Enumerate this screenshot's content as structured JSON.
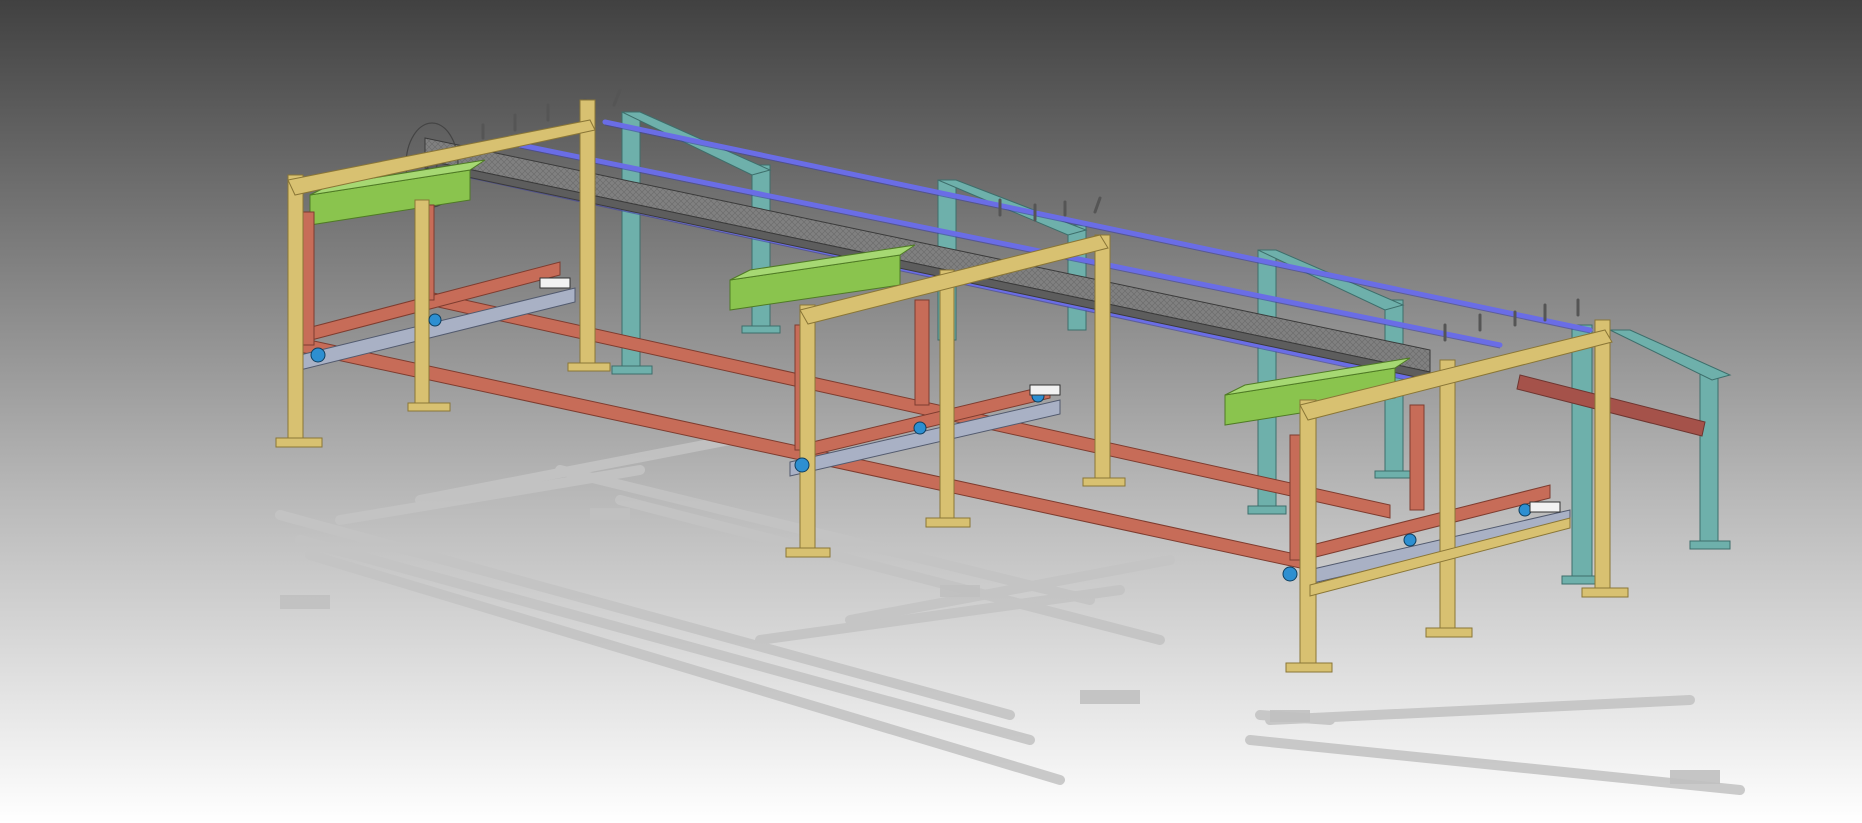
{
  "viewport": {
    "background_top": "#414141",
    "background_bottom": "#ffffff"
  },
  "model": {
    "colors": {
      "posts": "#d8c171",
      "frame": "#c76c58",
      "arms": "#8ac44e",
      "rails": "#6a6de6",
      "towers": "#6eb0ab",
      "beam": "#7c7c7c",
      "trays": "#a9b1c5",
      "casters": "#2d8fd1",
      "shadow": "#c9c9c9"
    },
    "icons": [
      "caster-wheel-icon",
      "clamp-jig-icon"
    ]
  }
}
